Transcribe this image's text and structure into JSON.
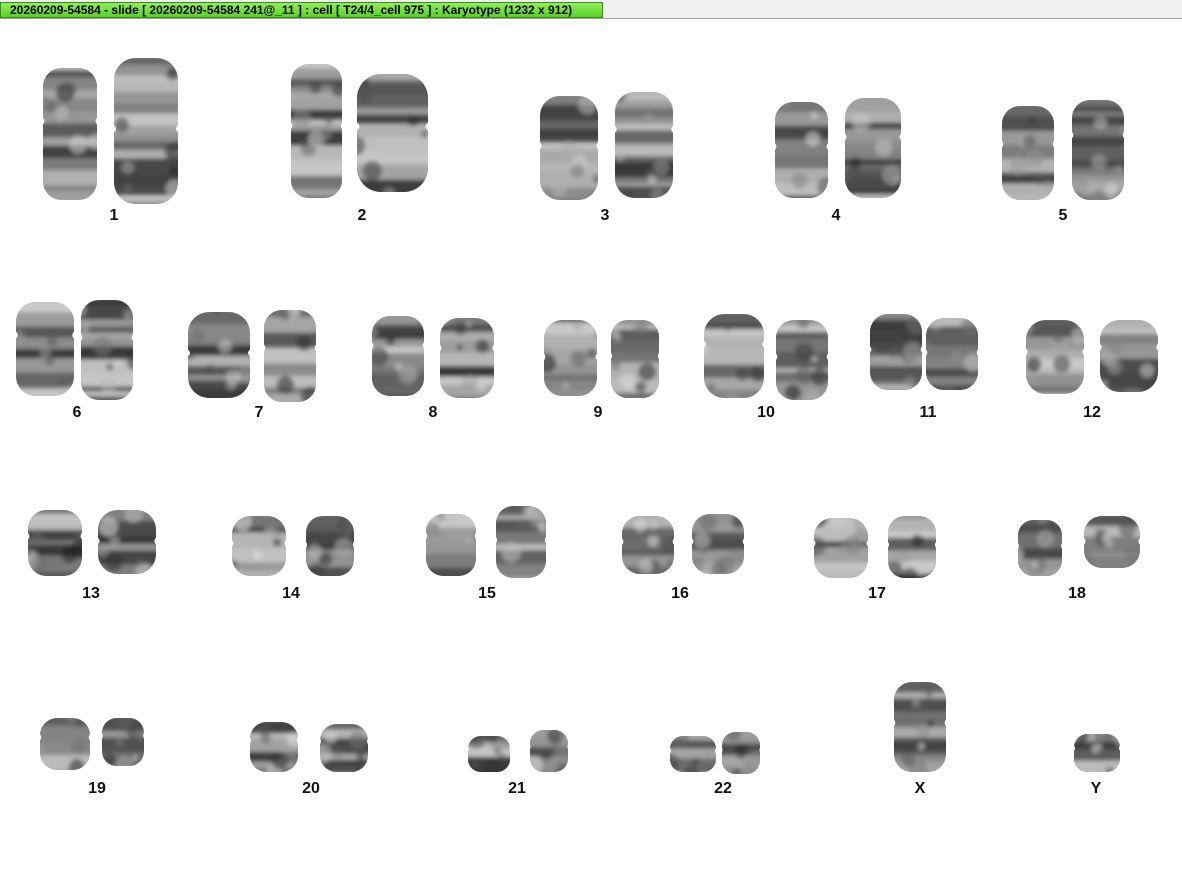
{
  "window": {
    "title": "20260209-54584 - slide [ 20260209-54584 241@_11 ] : cell [ T24/4_cell 975 ] : Karyotype  (1232 x 912)"
  },
  "karyotype": {
    "labels": [
      "1",
      "2",
      "3",
      "4",
      "5",
      "6",
      "7",
      "8",
      "9",
      "10",
      "11",
      "12",
      "13",
      "14",
      "15",
      "16",
      "17",
      "18",
      "19",
      "20",
      "21",
      "22",
      "X",
      "Y"
    ]
  }
}
